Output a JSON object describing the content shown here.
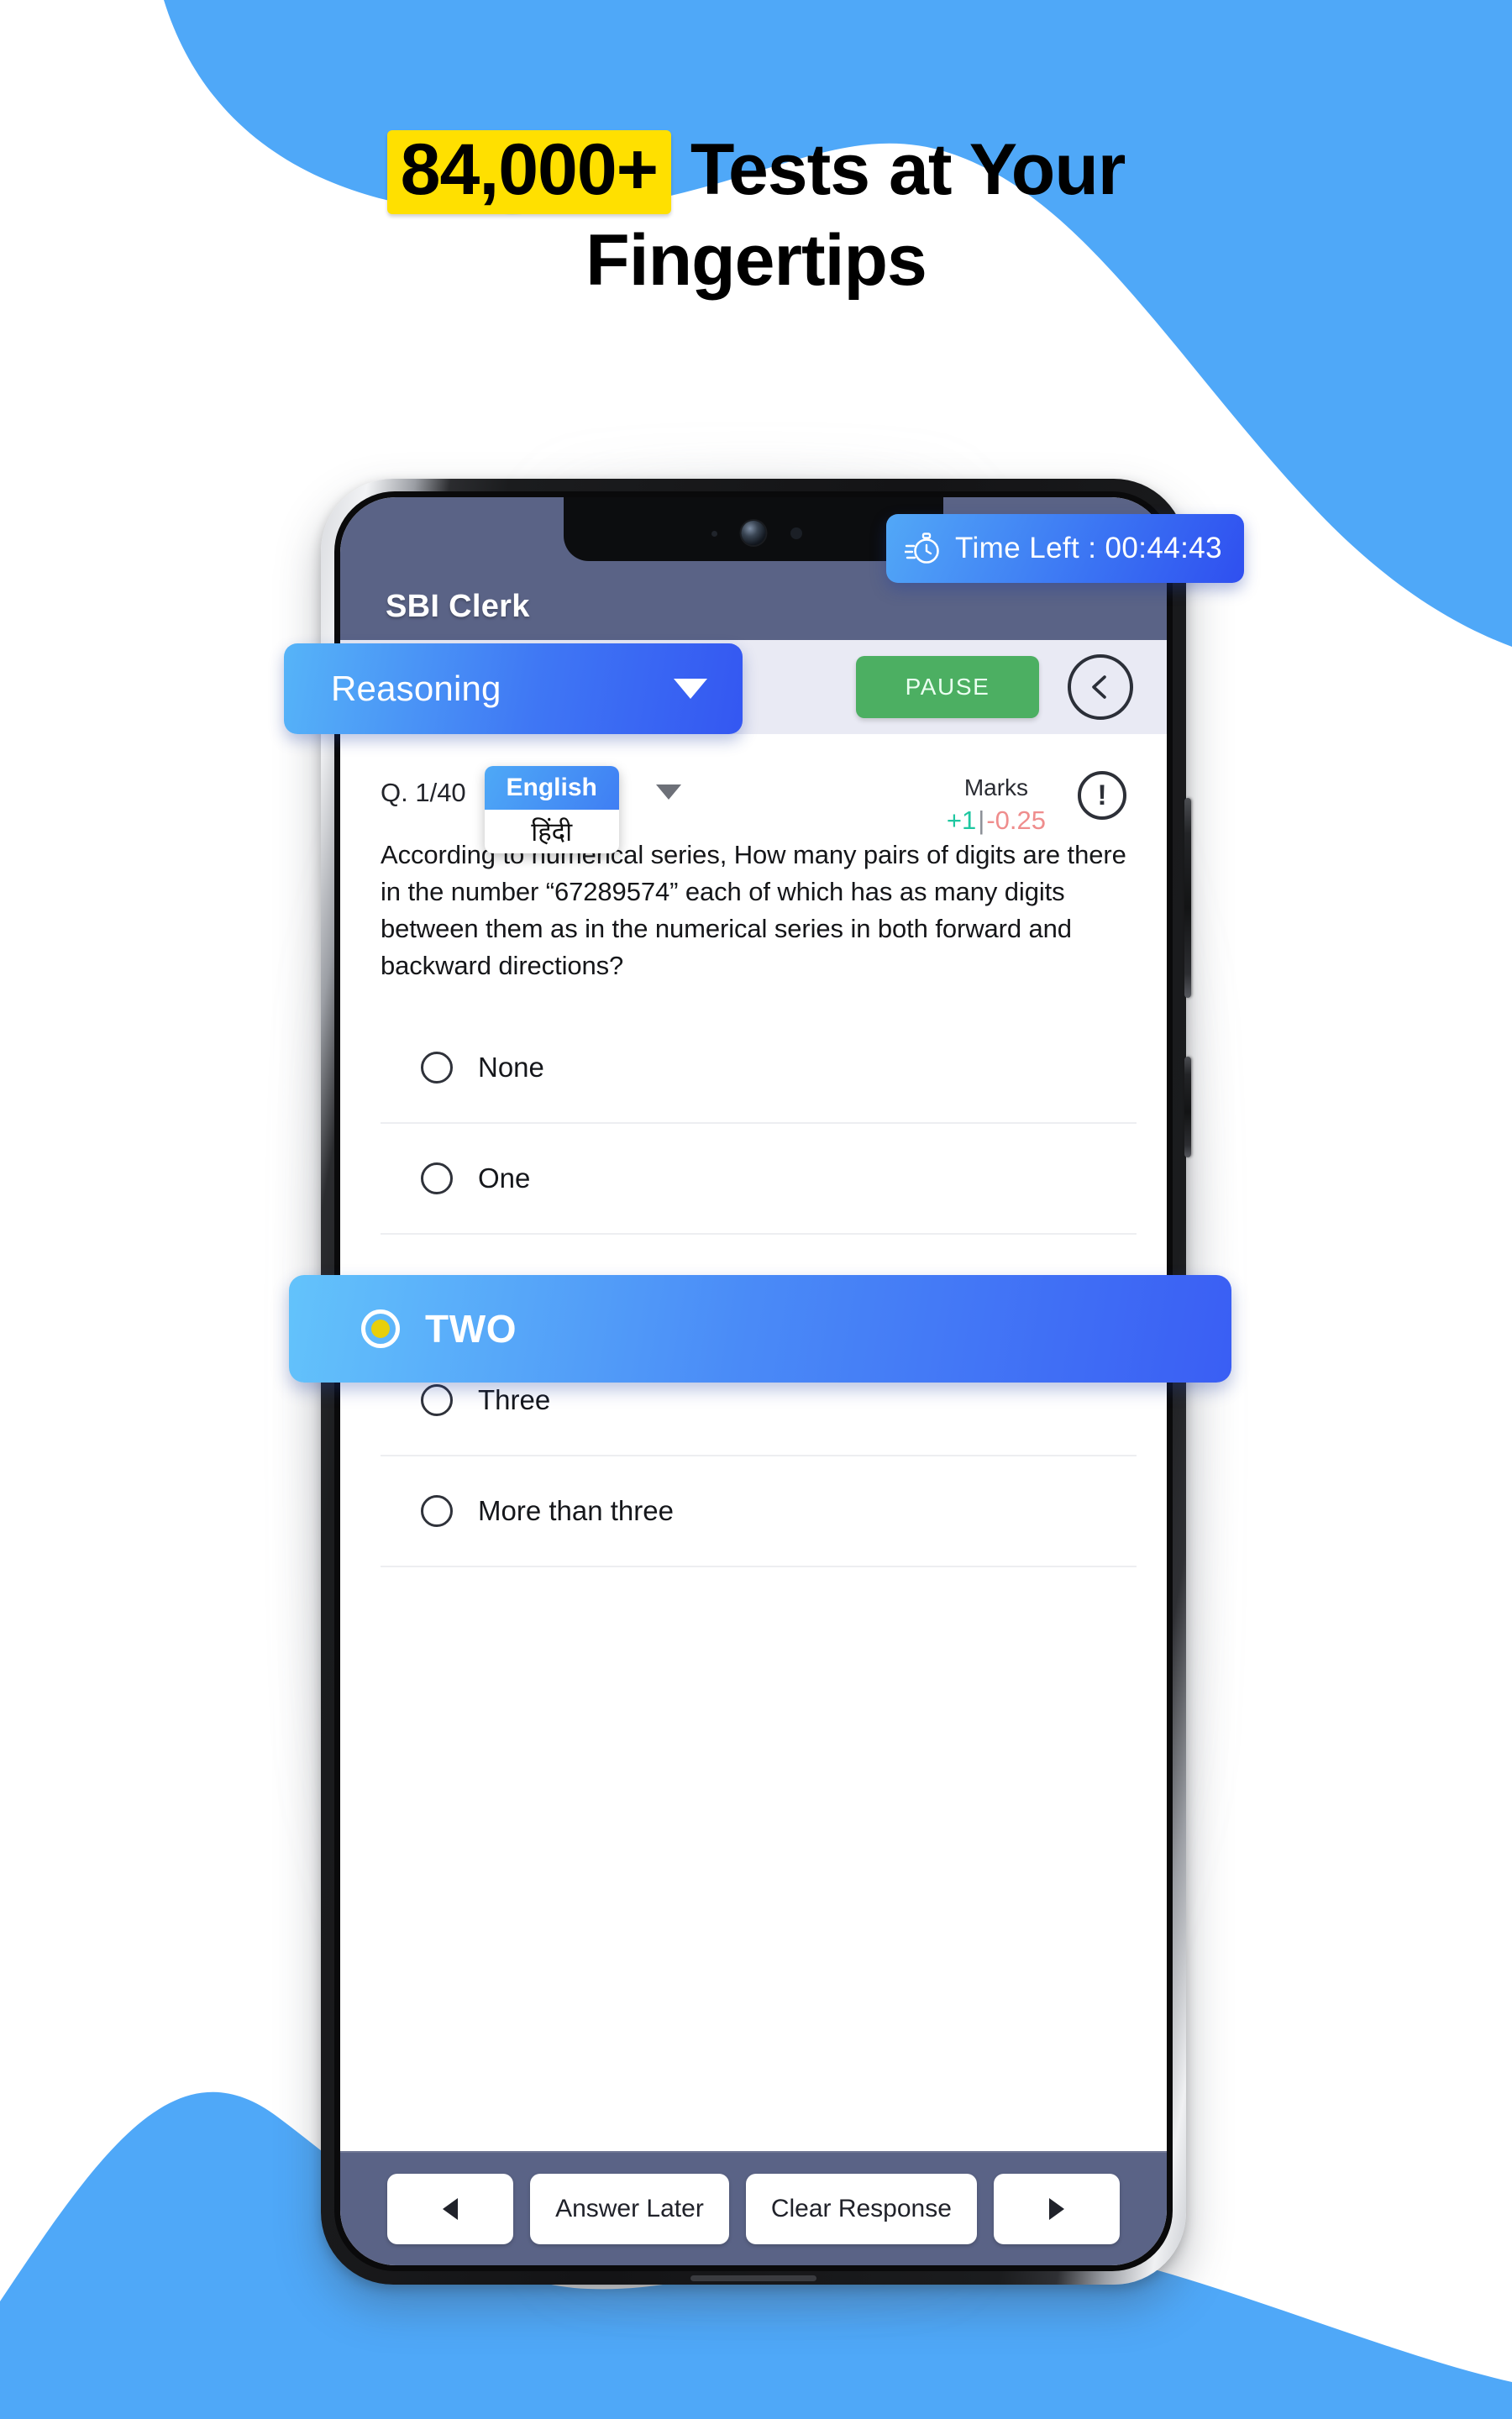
{
  "headline": {
    "badge": "84,000+",
    "rest_line1": "Tests at Your",
    "line2": "Fingertips"
  },
  "colors": {
    "wave_blue": "#4FA8F8",
    "badge_yellow": "#FFE000",
    "header_slate": "#5A6386",
    "accent_blue": "#3A5EF4",
    "pause_green": "#4CAF62",
    "marks_positive": "#1FC7A0",
    "marks_negative": "#EF8D8D",
    "selected_radio_yellow": "#E8CF0A"
  },
  "app": {
    "title": "SBI Clerk",
    "timer": {
      "icon": "stopwatch-icon",
      "label": "Time Left : 00:44:43"
    },
    "toolbar": {
      "subject": "Reasoning",
      "subject_caret_icon": "chevron-down-icon",
      "pause_label": "PAUSE",
      "back_icon": "chevron-left-icon"
    },
    "question": {
      "counter": "Q. 1/40",
      "language_options": [
        "English",
        "हिंदी"
      ],
      "language_selected": "English",
      "language_caret_icon": "chevron-down-icon",
      "marks_title": "Marks",
      "marks_positive": "+1",
      "marks_separator": "|",
      "marks_negative": "-0.25",
      "info_icon": "exclamation-circle-icon",
      "text": "According to numerical series, How many pairs of digits are there in the number “67289574” each of which has as many digits between them as in the numerical series in both forward and backward directions?",
      "options": [
        {
          "label": "None",
          "selected": false
        },
        {
          "label": "One",
          "selected": false
        },
        {
          "label": "TWO",
          "selected": true
        },
        {
          "label": "Three",
          "selected": false
        },
        {
          "label": "More than three",
          "selected": false
        }
      ]
    },
    "bottom_nav": {
      "prev_icon": "triangle-left-icon",
      "answer_later": "Answer Later",
      "clear_response": "Clear Response",
      "next_icon": "triangle-right-icon"
    }
  }
}
